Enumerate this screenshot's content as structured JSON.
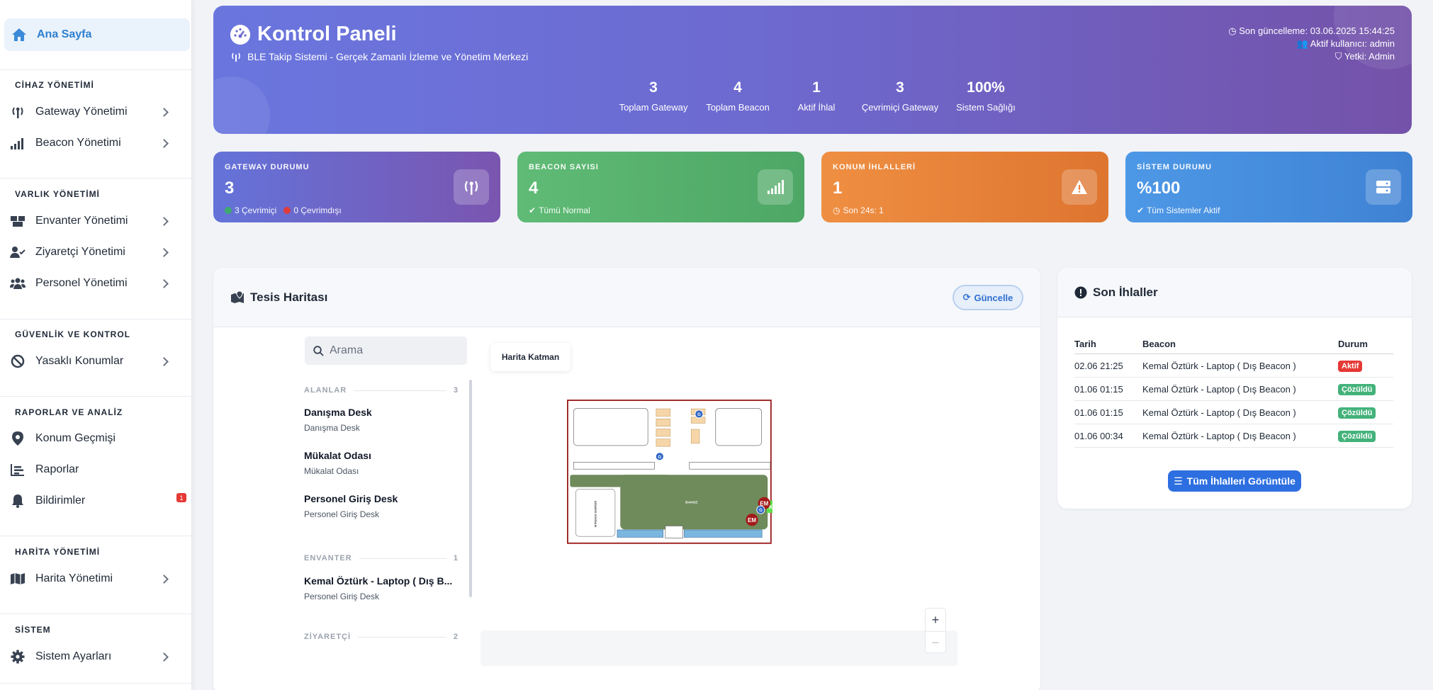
{
  "sidebar": {
    "home": "Ana Sayfa",
    "sections": {
      "device": "CİHAZ YÖNETİMİ",
      "asset": "VARLIK YÖNETİMİ",
      "security": "GÜVENLİK VE KONTROL",
      "reports": "RAPORLAR VE ANALİZ",
      "map": "HARİTA YÖNETİMİ",
      "system": "SİSTEM"
    },
    "items": {
      "gateway": "Gateway Yönetimi",
      "beacon": "Beacon Yönetimi",
      "inventory": "Envanter Yönetimi",
      "visitor": "Ziyaretçi Yönetimi",
      "personnel": "Personel Yönetimi",
      "restricted": "Yasaklı Konumlar",
      "history": "Konum Geçmişi",
      "reports": "Raporlar",
      "notifications": "Bildirimler",
      "map_mgmt": "Harita Yönetimi",
      "settings": "Sistem Ayarları"
    },
    "notification_count": "1"
  },
  "hero": {
    "title": "Kontrol Paneli",
    "subtitle": "BLE Takip Sistemi - Gerçek Zamanlı İzleme ve Yönetim Merkezi",
    "last_update": "Son güncelleme: 03.06.2025 15:44:25",
    "active_user": "Aktif kullanıcı: admin",
    "role": "Yetki: Admin",
    "stats": [
      {
        "value": "3",
        "label": "Toplam Gateway"
      },
      {
        "value": "4",
        "label": "Toplam Beacon"
      },
      {
        "value": "1",
        "label": "Aktif İhlal"
      },
      {
        "value": "3",
        "label": "Çevrimiçi Gateway"
      },
      {
        "value": "100%",
        "label": "Sistem Sağlığı"
      }
    ]
  },
  "cards": {
    "gateway": {
      "title": "GATEWAY DURUMU",
      "value": "3",
      "online": "3 Çevrimiçi",
      "offline": "0 Çevrimdışı"
    },
    "beacon": {
      "title": "BEACON SAYISI",
      "value": "4",
      "status": "Tümü Normal"
    },
    "violations": {
      "title": "KONUM İHLALLERİ",
      "value": "1",
      "status": "Son 24s: 1"
    },
    "system": {
      "title": "SİSTEM DURUMU",
      "value": "%100",
      "status": "Tüm Sistemler Aktif"
    }
  },
  "colors": {
    "gateway_card": "#6a63c9",
    "beacon_card": "#56b06f",
    "violation_card": "#e8823a",
    "system_card": "#4a8ee0"
  },
  "map": {
    "title": "Tesis Haritası",
    "refresh": "Güncelle",
    "search_placeholder": "Arama",
    "layer_tab": "Harita Katman",
    "sections": {
      "areas": {
        "label": "ALANLAR",
        "count": "3"
      },
      "inventory": {
        "label": "ENVANTER",
        "count": "1"
      },
      "visitor": {
        "label": "ZİYARETÇİ",
        "count": "2"
      }
    },
    "areas": [
      {
        "name": "Danışma Desk",
        "desc": "Danışma Desk"
      },
      {
        "name": "Mükalat Odası",
        "desc": "Mükalat Odası"
      },
      {
        "name": "Personel Giriş Desk",
        "desc": "Personel Giriş Desk"
      }
    ],
    "inventory": [
      {
        "name": "Kemal Öztürk - Laptop ( Dış B...",
        "desc": "Personel Giriş Desk"
      }
    ],
    "floorplan": {
      "garden": "BAHÇE",
      "security": "NİZAMİYE GÜVENLİK",
      "marker_g": "G",
      "marker_em": "EM",
      "marker_ke": "KE"
    },
    "zoom_in": "+",
    "zoom_out": "−"
  },
  "violations": {
    "title": "Son İhlaller",
    "headers": [
      "Tarih",
      "Beacon",
      "Durum"
    ],
    "rows": [
      {
        "date": "02.06 21:25",
        "beacon": "Kemal Öztürk - Laptop ( Dış Beacon )",
        "status": "Aktif",
        "color": "#e53935"
      },
      {
        "date": "01.06 01:15",
        "beacon": "Kemal Öztürk - Laptop ( Dış Beacon )",
        "status": "Çözüldü",
        "color": "#43b27a"
      },
      {
        "date": "01.06 01:15",
        "beacon": "Kemal Öztürk - Laptop ( Dış Beacon )",
        "status": "Çözüldü",
        "color": "#43b27a"
      },
      {
        "date": "01.06 00:34",
        "beacon": "Kemal Öztürk - Laptop ( Dış Beacon )",
        "status": "Çözüldü",
        "color": "#43b27a"
      }
    ],
    "view_all": "Tüm İhlalleri Görüntüle"
  }
}
